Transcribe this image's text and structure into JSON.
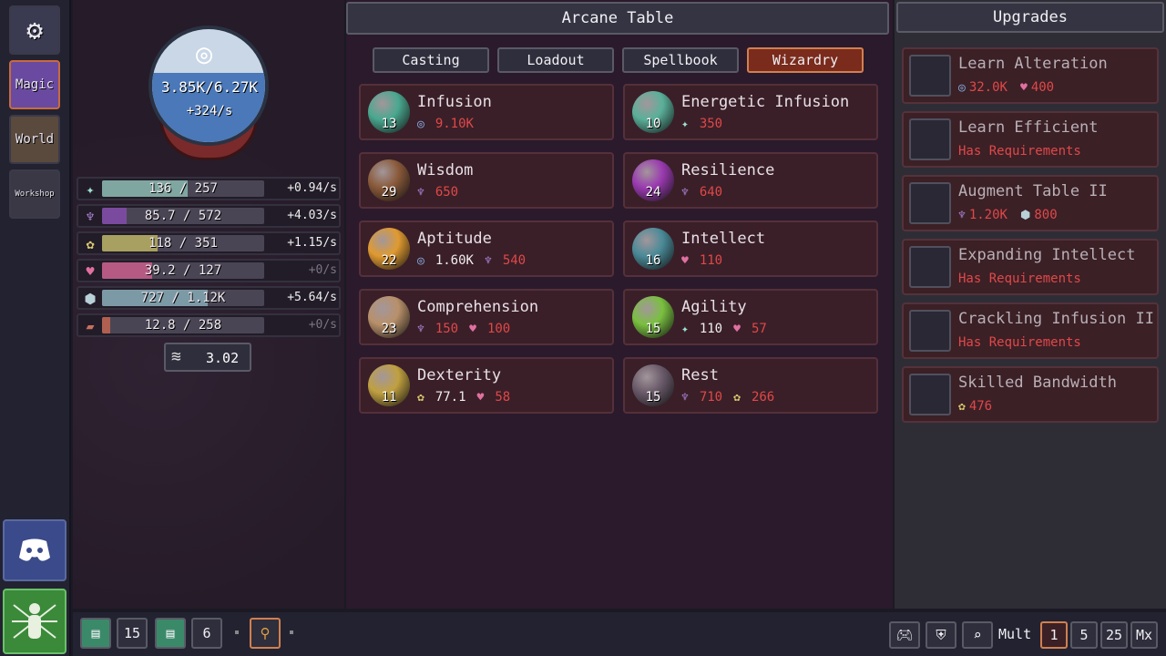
{
  "nav": {
    "settings_icon": "gear-icon",
    "magic_label": "Magic",
    "world_label": "World",
    "workshop_label": "Workshop",
    "discord_icon": "discord-icon",
    "character_icon": "character-icon"
  },
  "mana": {
    "amount": "3.85K/6.27K",
    "rate": "+324/s",
    "fill": 0.61
  },
  "resources": [
    {
      "icon": "shuriken-icon",
      "value": "136 / 257",
      "rate": "+0.94/s",
      "fill": 0.53,
      "color": "#7fa6a0"
    },
    {
      "icon": "lotus-icon",
      "value": "85.7 / 572",
      "rate": "+4.03/s",
      "fill": 0.15,
      "color": "#7a4a9e"
    },
    {
      "icon": "wheat-icon",
      "value": "118 / 351",
      "rate": "+1.15/s",
      "fill": 0.34,
      "color": "#a8a060"
    },
    {
      "icon": "heart-icon",
      "value": "39.2 / 127",
      "rate": "+0/s",
      "fill": 0.31,
      "color": "#b65a84"
    },
    {
      "icon": "cube-icon",
      "value": "727 / 1.12K",
      "rate": "+5.64/s",
      "fill": 0.65,
      "color": "#7c9aa6"
    },
    {
      "icon": "bandage-icon",
      "value": "12.8 / 258",
      "rate": "+0/s",
      "fill": 0.05,
      "color": "#b06050"
    }
  ],
  "scroll_value": "3.02",
  "center": {
    "title": "Arcane Table",
    "tabs": [
      "Casting",
      "Loadout",
      "Spellbook",
      "Wizardry"
    ],
    "active_tab": 3
  },
  "cards": [
    {
      "name": "Infusion",
      "level": "13",
      "color": "#4aa890",
      "costs": [
        {
          "icon": "swirl-icon",
          "value": "9.10K",
          "red": true
        }
      ]
    },
    {
      "name": "Energetic Infusion",
      "level": "10",
      "color": "#5ab09a",
      "costs": [
        {
          "icon": "shuriken-icon",
          "value": "350",
          "red": true
        }
      ]
    },
    {
      "name": "Wisdom",
      "level": "29",
      "color": "#8a5a3a",
      "costs": [
        {
          "icon": "lotus-icon",
          "value": "650",
          "red": true
        }
      ]
    },
    {
      "name": "Resilience",
      "level": "24",
      "color": "#9a3ab0",
      "costs": [
        {
          "icon": "lotus-icon",
          "value": "640",
          "red": true
        }
      ]
    },
    {
      "name": "Aptitude",
      "level": "22",
      "color": "#e09a30",
      "costs": [
        {
          "icon": "swirl-icon",
          "value": "1.60K",
          "red": false
        },
        {
          "icon": "lotus-icon",
          "value": "540",
          "red": true
        }
      ]
    },
    {
      "name": "Intellect",
      "level": "16",
      "color": "#4a8a98",
      "costs": [
        {
          "icon": "heart-icon",
          "value": "110",
          "red": true
        }
      ]
    },
    {
      "name": "Comprehension",
      "level": "23",
      "color": "#b8906a",
      "costs": [
        {
          "icon": "lotus-icon",
          "value": "150",
          "red": true
        },
        {
          "icon": "heart-icon",
          "value": "100",
          "red": true
        }
      ]
    },
    {
      "name": "Agility",
      "level": "15",
      "color": "#7ac040",
      "costs": [
        {
          "icon": "shuriken-icon",
          "value": "110",
          "red": false
        },
        {
          "icon": "heart-icon",
          "value": "57",
          "red": true
        }
      ]
    },
    {
      "name": "Dexterity",
      "level": "11",
      "color": "#c0a040",
      "costs": [
        {
          "icon": "wheat-icon",
          "value": "77.1",
          "red": false
        },
        {
          "icon": "heart-icon",
          "value": "58",
          "red": true
        }
      ]
    },
    {
      "name": "Rest",
      "level": "15",
      "color": "#6a5a6a",
      "costs": [
        {
          "icon": "lotus-icon",
          "value": "710",
          "red": true
        },
        {
          "icon": "wheat-icon",
          "value": "266",
          "red": true
        }
      ]
    }
  ],
  "upgrades": {
    "title": "Upgrades",
    "items": [
      {
        "name": "Learn Alteration",
        "icon": "spiral-emblem-icon",
        "line": "32.0K   400",
        "costs": [
          {
            "icon": "swirl-icon",
            "value": "32.0K"
          },
          {
            "icon": "heart-icon",
            "value": "400"
          }
        ]
      },
      {
        "name": "Learn Efficient",
        "icon": "leaf-icon",
        "req": "Has Requirements"
      },
      {
        "name": "Augment Table II",
        "icon": "rune-tablet-icon",
        "costs": [
          {
            "icon": "lotus-icon",
            "value": "1.20K"
          },
          {
            "icon": "cube-icon",
            "value": "800"
          }
        ]
      },
      {
        "name": "Expanding Intellect",
        "icon": "crystal-orb-icon",
        "req": "Has Requirements"
      },
      {
        "name": "Crackling Infusion II",
        "icon": "swirl-orb-icon",
        "req": "Has Requirements"
      },
      {
        "name": "Skilled Bandwidth",
        "icon": "feather-icon",
        "costs": [
          {
            "icon": "wheat-icon",
            "value": "476"
          }
        ]
      }
    ]
  },
  "bottom": {
    "slot1_count": "15",
    "slot2_count": "6",
    "mult_label": "Mult",
    "mult_options": [
      "1",
      "5",
      "25",
      "Mx"
    ],
    "mult_active": 0
  }
}
